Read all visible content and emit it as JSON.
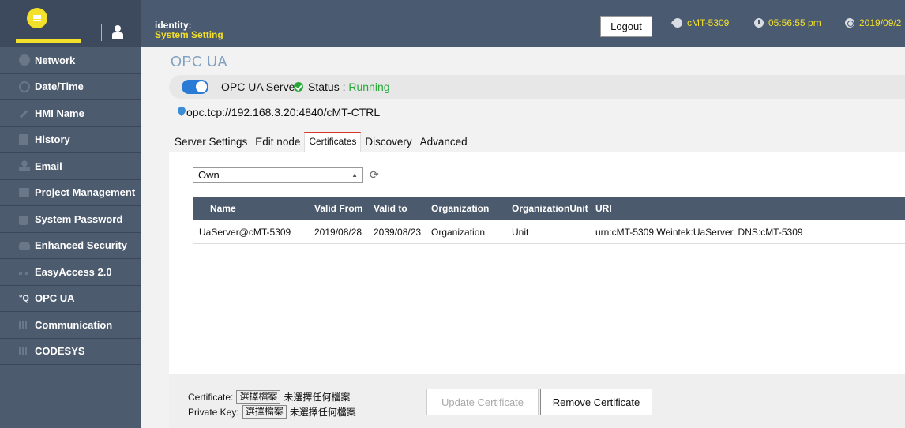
{
  "header": {
    "identity_line1": "identity:",
    "identity_line2": "System Setting",
    "logout_label": "Logout",
    "device_name": "cMT-5309",
    "time": "05:56:55 pm",
    "date": "2019/09/2",
    "accent_color": "#f3e02a"
  },
  "sidebar": {
    "items": [
      {
        "label": "Network",
        "icon": "network-icon"
      },
      {
        "label": "Date/Time",
        "icon": "clock-icon"
      },
      {
        "label": "HMI Name",
        "icon": "pen-icon"
      },
      {
        "label": "History",
        "icon": "document-icon"
      },
      {
        "label": "Email",
        "icon": "person-icon"
      },
      {
        "label": "Project Management",
        "icon": "folder-icon"
      },
      {
        "label": "System Password",
        "icon": "lock-icon"
      },
      {
        "label": "Enhanced Security",
        "icon": "users-icon"
      },
      {
        "label": "EasyAccess 2.0",
        "icon": "bolt-icon"
      },
      {
        "label": "OPC UA",
        "icon": "opcua-icon"
      },
      {
        "label": "Communication",
        "icon": "grid-icon"
      },
      {
        "label": "CODESYS",
        "icon": "grid-icon"
      }
    ]
  },
  "main": {
    "title": "OPC UA",
    "server_label": "OPC UA Server",
    "status_label": "Status : ",
    "status_value": "Running",
    "server_enabled": true,
    "endpoint": "opc.tcp://192.168.3.20:4840/cMT-CTRL",
    "tabs": [
      "Server Settings",
      "Edit node",
      "Certificates",
      "Discovery",
      "Advanced"
    ],
    "active_tab": "Certificates",
    "cert_store": "Own",
    "table": {
      "headers": [
        "Name",
        "Valid From",
        "Valid to",
        "Organization",
        "OrganizationUnit",
        "URI"
      ],
      "rows": [
        [
          "UaServer@cMT-5309",
          "2019/08/28",
          "2039/08/23",
          "Organization",
          "Unit",
          "urn:cMT-5309:Weintek:UaServer, DNS:cMT-5309"
        ]
      ]
    }
  },
  "footer": {
    "certificate_label": "Certificate:",
    "private_key_label": "Private Key:",
    "choose_file": "選擇檔案",
    "no_file": "未選擇任何檔案",
    "update_label": "Update Certificate",
    "remove_label": "Remove Certificate"
  },
  "colors": {
    "header_bg": "#4a5a70",
    "sidebar_bg": "#4d5b6e",
    "status_green": "#29a83a",
    "toggle_blue": "#2a7bd6",
    "title_blue": "#7fa0c0",
    "tab_active_red": "#d9362b"
  }
}
